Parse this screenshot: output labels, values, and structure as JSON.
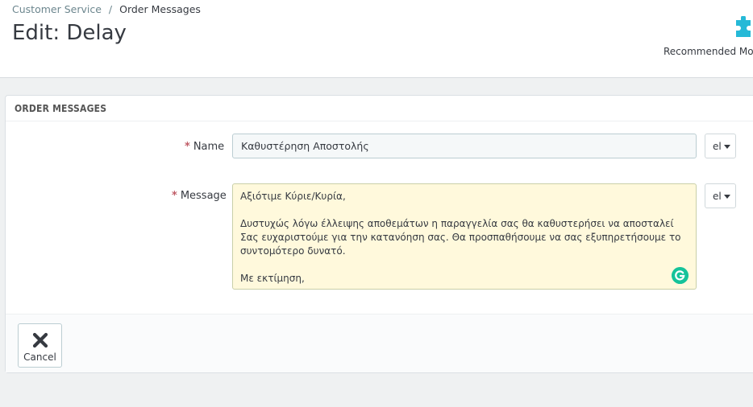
{
  "breadcrumb": {
    "parent": "Customer Service",
    "separator": "/",
    "current": "Order Messages"
  },
  "page_title": "Edit: Delay",
  "toolbar": {
    "recommended_label": "Recommended Mod",
    "recommended_icon": "puzzle-icon"
  },
  "panel": {
    "heading": "ORDER MESSAGES"
  },
  "form": {
    "required_mark": "*",
    "name_label": "Name",
    "name_value": "Καθυστέρηση Αποστολής",
    "message_label": "Message",
    "message_lines": [
      "Αξιότιμε Κύριε/Κυρία,",
      "",
      "Δυστυχώς λόγω έλλειψης αποθεμάτων η παραγγελία σας θα καθυστερήσει να αποσταλεί",
      "Σας ευχαριστούμε για την κατανόηση σας. Θα προσπαθήσουμε να σας εξυπηρετήσουμε το",
      "συντομότερο δυνατό.",
      "",
      "Με εκτίμηση,"
    ],
    "lang_name": "el",
    "lang_message": "el"
  },
  "footer": {
    "cancel_label": "Cancel",
    "cancel_icon": "close-icon"
  },
  "colors": {
    "required": "#c05c67",
    "accent": "#25b9d7",
    "message_bg": "#fff9dc",
    "grammarly": "#15c39a"
  }
}
